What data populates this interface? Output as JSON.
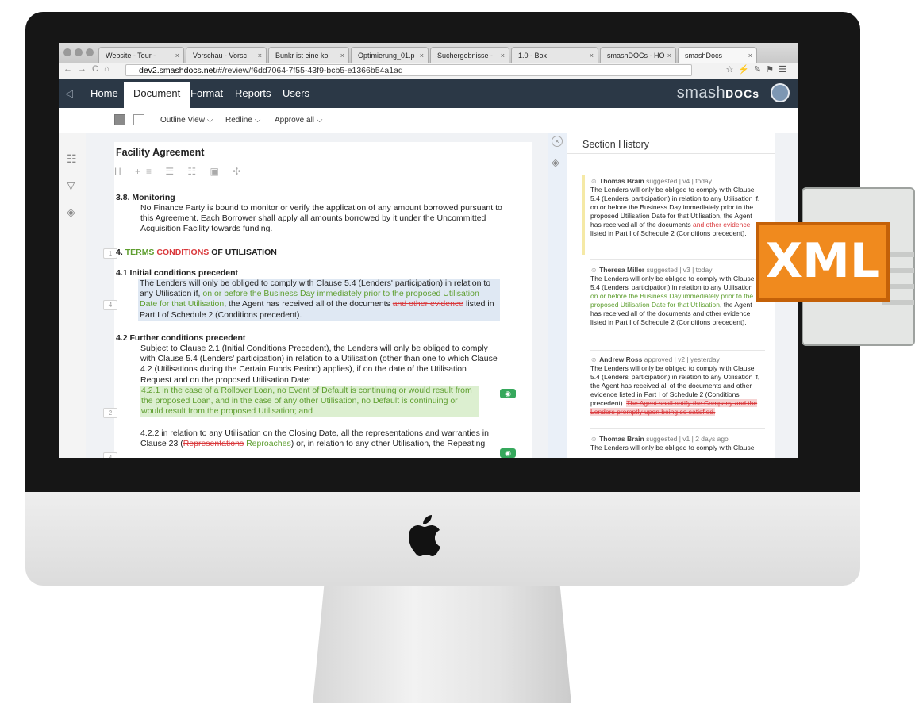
{
  "browser": {
    "tabs": [
      {
        "label": "Website - Tour -"
      },
      {
        "label": "Vorschau - Vorsc"
      },
      {
        "label": "Bunkr ist eine kol"
      },
      {
        "label": "Optimierung_01.p"
      },
      {
        "label": "Suchergebnisse -"
      },
      {
        "label": "1.0 - Box"
      },
      {
        "label": "smashDOCs - HO"
      },
      {
        "label": "smashDocs"
      }
    ],
    "url_host": "dev2.smashdocs.net",
    "url_path": "/#/review/f6dd7064-7f55-43f9-bcb5-e1366b54a1ad"
  },
  "nav": {
    "items": [
      "Home",
      "Document",
      "Format",
      "Reports",
      "Users"
    ],
    "brand": "smash",
    "brand_bold": "DOCs"
  },
  "toolbar": {
    "outline": "Outline View",
    "redline": "Redline",
    "approve": "Approve all"
  },
  "doc": {
    "title": "Facility Agreement",
    "s38_title": "3.8. Monitoring",
    "s38_text": "No Finance Party is bound to monitor or verify the application of any amount borrowed pursuant to this Agreement. Each Borrower shall apply all amounts borrowed by it under the Uncommitted Acquisition Facility towards funding.",
    "s4_num": "4.",
    "s4_ins": "TERMS",
    "s4_del": "CONDITIONS",
    "s4_rest": "OF UTILISATION",
    "s41_title": "4.1 Initial conditions precedent",
    "s41_a": "The Lenders will only be obliged to comply with Clause 5.4 (Lenders' participation) in relation to any Utilisation if,",
    "s41_ins": "on or before the Business Day immediately prior to the proposed Utilisation Date for that Utilisation",
    "s41_b": ", the Agent has received all of the documents",
    "s41_del": "and other evidence",
    "s41_c": "listed in Part I of Schedule 2 (Conditions precedent).",
    "s42_title": "4.2 Further conditions precedent",
    "s42_text": "Subject to Clause 2.1 (Initial Conditions Precedent), the Lenders will only be obliged to comply with Clause 5.4 (Lenders' participation) in relation to a Utilisation (other than one to which Clause 4.2 (Utilisations during the Certain Funds Period) applies), if on the date of the Utilisation Request and on the proposed Utilisation Date:",
    "s421": "4.2.1 in the case of a Rollover Loan, no Event of Default is continuing or would result from the proposed Loan, and in the case of any other Utilisation, no Default is continuing or would result from the proposed Utilisation; and",
    "s422_a": "4.2.2 in relation to any Utilisation on the Closing Date, all the representations and warranties in Clause 23 (",
    "s422_del": "Representations",
    "s422_ins": "Reproaches",
    "s422_b": ") or, in relation to any other Utilisation, the Repeating",
    "numbers": [
      "1",
      "4",
      "2",
      "4"
    ]
  },
  "history": {
    "title": "Section History",
    "entries": [
      {
        "name": "Thomas Brain",
        "meta": "suggested | v4 | today",
        "a": "The Lenders will only be obliged to comply with Clause 5.4 (Lenders' participation) in relation to any Utilisation if. on or before the Business Day immediately prior to the proposed Utilisation Date for that Utilisation, the Agent has received all of the documents",
        "del": "and other evidence",
        "b": "listed in Part I of Schedule 2 (Conditions precedent)."
      },
      {
        "name": "Theresa Miller",
        "meta": "suggested | v3 | today",
        "a": "The Lenders will only be obliged to comply with Clause 5.4 (Lenders' participation) in relation to any Utilisation if,",
        "ins": "on or before the Business Day immediately prior to the proposed Utilisation Date for that Utilisation",
        "b": ", the Agent has received all of the documents and other evidence listed in Part I of Schedule 2 (Conditions precedent)."
      },
      {
        "name": "Andrew Ross",
        "meta": "approved | v2 | yesterday",
        "a": "The Lenders will only be obliged to comply with Clause 5.4 (Lenders' participation) in relation to any Utilisation if, the Agent has received all of the documents and other evidence listed in Part I of Schedule 2 (Conditions precedent).",
        "del": "The Agent shall notify the Company and the Lenders promptly upon being so satisfied."
      },
      {
        "name": "Thomas Brain",
        "meta": "suggested | v1 | 2 days ago",
        "a": "The Lenders will only be obliged to comply with Clause"
      }
    ]
  },
  "badge": "XML",
  "colors": {
    "nav_bg": "#2b3846",
    "insert": "#5e9e2f",
    "delete": "#d9393c",
    "xml_orange": "#f08a1e",
    "approve_green": "#36a85c"
  }
}
